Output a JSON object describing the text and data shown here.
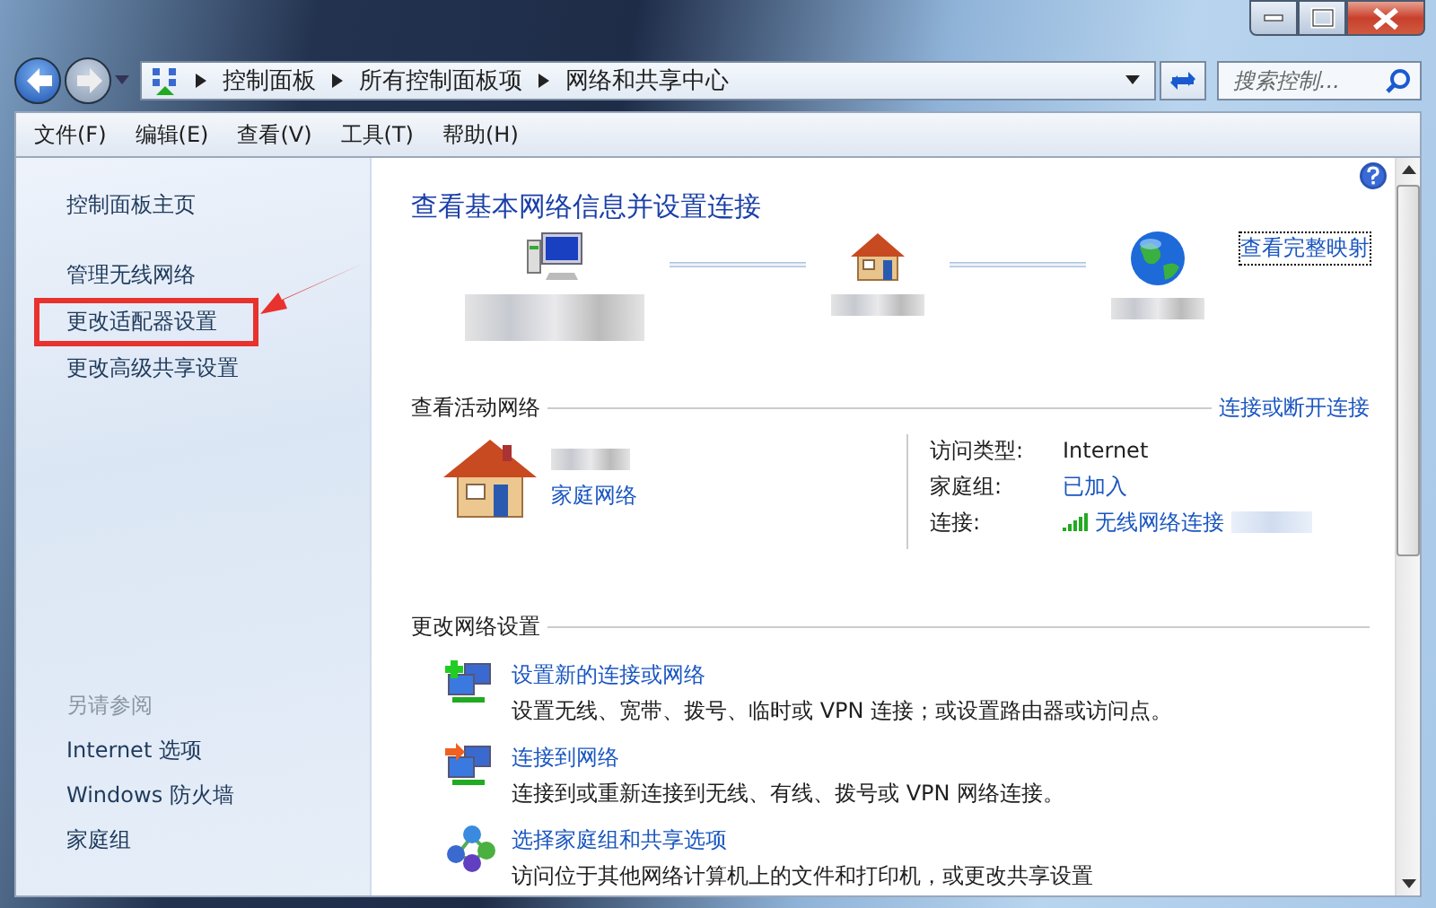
{
  "window": {
    "buttons": [
      {
        "kind": "minimize"
      },
      {
        "kind": "maximize"
      },
      {
        "kind": "close"
      }
    ]
  },
  "address_bar": {
    "breadcrumbs": [
      "控制面板",
      "所有控制面板项",
      "网络和共享中心"
    ]
  },
  "search": {
    "placeholder": "搜索控制..."
  },
  "menu": [
    "文件(F)",
    "编辑(E)",
    "查看(V)",
    "工具(T)",
    "帮助(H)"
  ],
  "sidebar": {
    "links": [
      {
        "label": "控制面板主页",
        "annotated": false
      },
      {
        "label": "管理无线网络",
        "annotated": false
      },
      {
        "label": "更改适配器设置",
        "annotated": true
      },
      {
        "label": "更改高级共享设置",
        "annotated": false
      }
    ],
    "see_also": {
      "title": "另请参阅",
      "links": [
        "Internet 选项",
        "Windows 防火墙",
        "家庭组"
      ]
    }
  },
  "main": {
    "title": "查看基本网络信息并设置连接",
    "map": {
      "nodes": [
        {
          "kind": "computer"
        },
        {
          "kind": "house"
        },
        {
          "kind": "globe"
        }
      ],
      "link": {
        "label": "查看完整映射",
        "focused": true
      }
    },
    "active": {
      "heading": "查看活动网络",
      "action": "连接或断开连接",
      "network_type": "家庭网络",
      "details": [
        {
          "label": "访问类型:",
          "value": "Internet",
          "kind": "text"
        },
        {
          "label": "家庭组:",
          "value": "已加入",
          "kind": "link"
        },
        {
          "label": "连接:",
          "value": "无线网络连接",
          "kind": "wifi-link"
        }
      ]
    },
    "change": {
      "heading": "更改网络设置",
      "tasks": [
        {
          "kind": "new-connection",
          "title": "设置新的连接或网络",
          "description": "设置无线、宽带、拨号、临时或 VPN 连接；或设置路由器或访问点。"
        },
        {
          "kind": "connect",
          "title": "连接到网络",
          "description": "连接到或重新连接到无线、有线、拨号或 VPN 网络连接。"
        },
        {
          "kind": "homegroup",
          "title": "选择家庭组和共享选项",
          "description": "访问位于其他网络计算机上的文件和打印机，或更改共享设置"
        }
      ]
    }
  }
}
